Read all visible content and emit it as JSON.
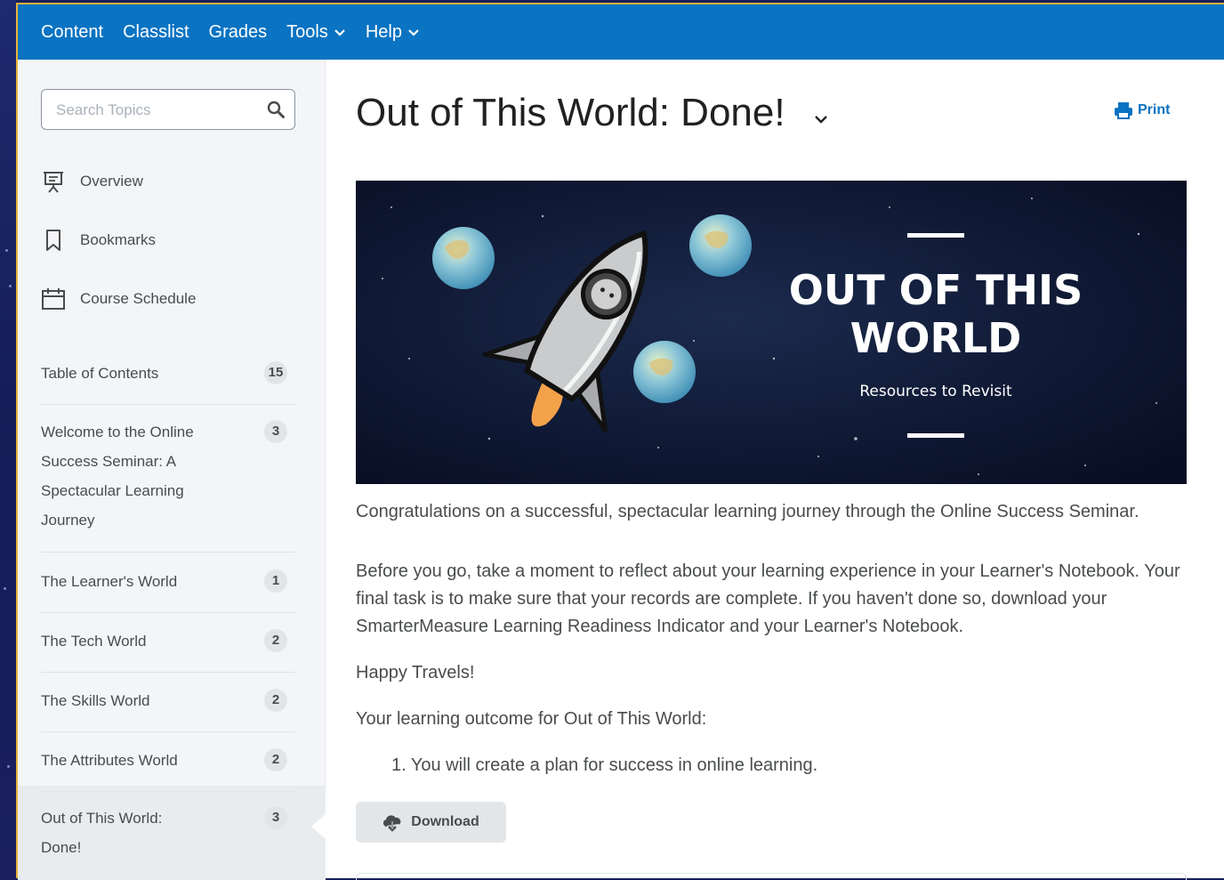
{
  "nav": {
    "items": [
      {
        "label": "Content",
        "has_menu": false
      },
      {
        "label": "Classlist",
        "has_menu": false
      },
      {
        "label": "Grades",
        "has_menu": false
      },
      {
        "label": "Tools",
        "has_menu": true
      },
      {
        "label": "Help",
        "has_menu": true
      }
    ]
  },
  "sidebar": {
    "search_placeholder": "Search Topics",
    "overview": "Overview",
    "bookmarks": "Bookmarks",
    "schedule": "Course Schedule",
    "toc_label": "Table of Contents",
    "toc_count": "15",
    "modules": [
      {
        "label": "Welcome to the Online Success Seminar: A Spectacular Learning Journey",
        "count": "3"
      },
      {
        "label": "The Learner's World",
        "count": "1"
      },
      {
        "label": "The Tech World",
        "count": "2"
      },
      {
        "label": "The Skills World",
        "count": "2"
      },
      {
        "label": "The Attributes World",
        "count": "2"
      },
      {
        "label": "Out of This World: Done!",
        "count": "3"
      }
    ]
  },
  "main": {
    "title": "Out of This World: Done!",
    "print_label": "Print",
    "banner": {
      "title_line1": "OUT OF THIS",
      "title_line2": "WORLD",
      "subtitle": "Resources to Revisit"
    },
    "paragraphs": [
      "Congratulations on a successful, spectacular learning journey through the Online Success Seminar.",
      "Before you go, take a moment to reflect about your learning experience in your Learner's Notebook. Your final task is to make sure that your records are complete. If you haven't done so, download your SmarterMeasure Learning Readiness Indicator and your Learner's Notebook.",
      "Happy Travels!",
      "Your learning outcome for Out of This World:"
    ],
    "outcomes": [
      "1. You will create a plan for success in online learning."
    ],
    "download_label": "Download"
  },
  "colors": {
    "navbar": "#0a73c2",
    "accent": "#0a73c2",
    "banner_bg": "#0b1530"
  }
}
